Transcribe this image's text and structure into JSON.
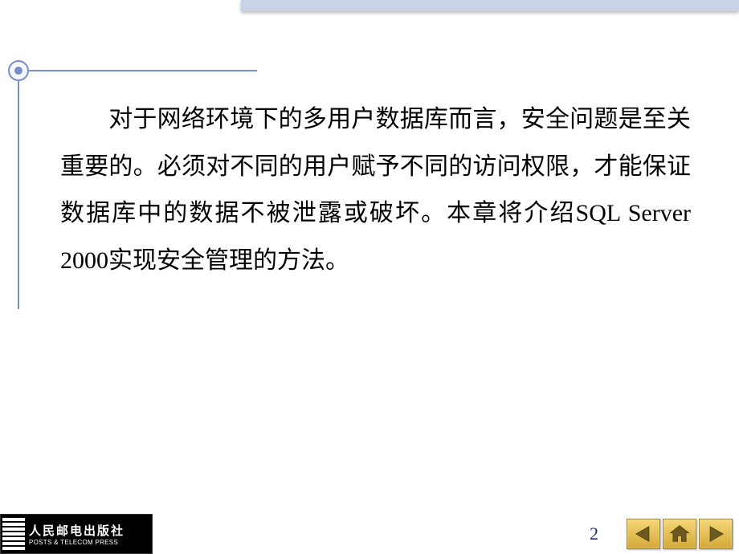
{
  "content": {
    "paragraph": "对于网络环境下的多用户数据库而言，安全问题是至关重要的。必须对不同的用户赋予不同的访问权限，才能保证数据库中的数据不被泄露或破坏。本章将介绍SQL Server 2000实现安全管理的方法。"
  },
  "page_number": "2",
  "publisher": {
    "name_cn": "人民邮电出版社",
    "name_en": "POSTS & TELECOM PRESS"
  },
  "colors": {
    "accent": "#7a8fc7",
    "top_bar": "#c9d2e6",
    "nav_button": "#e8c968"
  }
}
